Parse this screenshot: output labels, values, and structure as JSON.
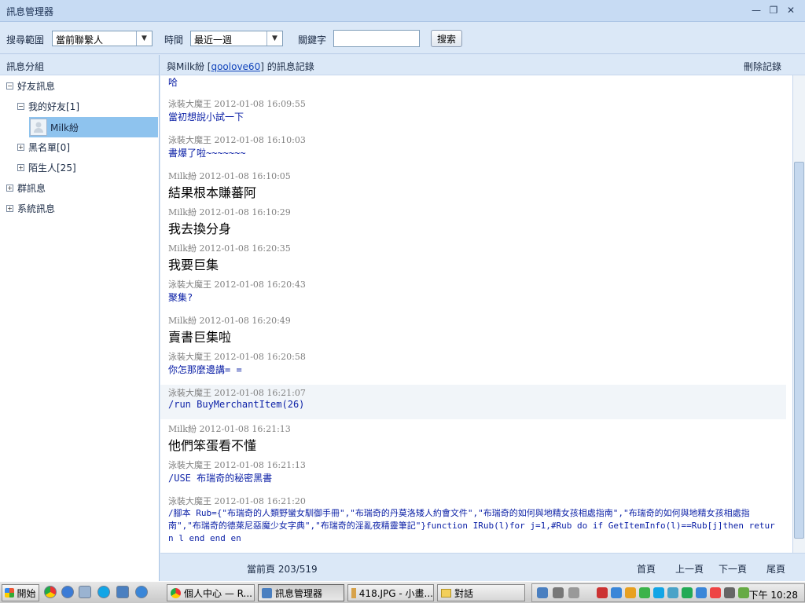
{
  "window": {
    "title": "訊息管理器"
  },
  "toolbar": {
    "scope_label": "搜尋範圍",
    "scope_value": "當前聯繫人",
    "time_label": "時間",
    "time_value": "最近一週",
    "keyword_label": "關鍵字",
    "keyword_value": "",
    "search_button": "搜索"
  },
  "sidebar": {
    "header": "訊息分組",
    "items": [
      {
        "label": "好友訊息",
        "expander": "⊟"
      },
      {
        "label": "我的好友[1]",
        "expander": "⊟"
      },
      {
        "label": "Milk紛",
        "expander": ""
      },
      {
        "label": "黑名單[0]",
        "expander": "⊞"
      },
      {
        "label": "陌生人[25]",
        "expander": "⊞"
      },
      {
        "label": "群訊息",
        "expander": "⊞"
      },
      {
        "label": "系統訊息",
        "expander": "⊞"
      }
    ]
  },
  "conversation": {
    "title_prefix": "與Milk紛 [",
    "contact_id": "qoolove60",
    "title_suffix": "] 的訊息記錄",
    "delete_label": "刪除記錄",
    "top_fragment": "哈",
    "messages": [
      {
        "sender": "泳裝大魔王",
        "time": "2012-01-08 16:09:55",
        "text": "當初想說小試一下",
        "style": "small"
      },
      {
        "sender": "泳裝大魔王",
        "time": "2012-01-08 16:10:03",
        "text": "書爆了啦~~~~~~~",
        "style": "small"
      },
      {
        "sender": "Milk紛",
        "time": "2012-01-08 16:10:05",
        "text": "結果根本賺蕃阿",
        "style": "big"
      },
      {
        "sender": "Milk紛",
        "time": "2012-01-08 16:10:29",
        "text": "我去換分身",
        "style": "big"
      },
      {
        "sender": "Milk紛",
        "time": "2012-01-08 16:20:35",
        "text": "我要巨集",
        "style": "big"
      },
      {
        "sender": "泳裝大魔王",
        "time": "2012-01-08 16:20:43",
        "text": "聚集?",
        "style": "small"
      },
      {
        "sender": "Milk紛",
        "time": "2012-01-08 16:20:49",
        "text": "賣書巨集啦",
        "style": "big"
      },
      {
        "sender": "泳裝大魔王",
        "time": "2012-01-08 16:20:58",
        "text": "你怎那麼邊講= =",
        "style": "small"
      },
      {
        "sender": "泳裝大魔王",
        "time": "2012-01-08 16:21:07",
        "text": "/run BuyMerchantItem(26)",
        "style": "small"
      },
      {
        "sender": "Milk紛",
        "time": "2012-01-08 16:21:13",
        "text": "他們笨蛋看不懂",
        "style": "big"
      },
      {
        "sender": "泳裝大魔王",
        "time": "2012-01-08 16:21:13",
        "text": "/USE 布瑞奇的秘密黑書",
        "style": "small"
      },
      {
        "sender": "泳裝大魔王",
        "time": "2012-01-08 16:21:20",
        "text": "/腳本 Rub={\"布瑞奇的人類野蠻女馴御手冊\",\"布瑞奇的丹莫洛矮人約會文件\",\"布瑞奇的如何與地精女孩相處指南\",\"布瑞奇的如何與地精女孩相處指南\",\"布瑞奇的德萊尼惡魔少女字典\",\"布瑞奇的淫亂夜精靈筆記\"}function IRub(l)for j=1,#Rub do if GetItemInfo(l)==Rub[j]then return l end end en",
        "style": "small"
      }
    ]
  },
  "pager": {
    "current_page": "當前頁 203/519",
    "first": "首頁",
    "prev": "上一頁",
    "next": "下一頁",
    "last": "尾頁"
  },
  "taskbar": {
    "start": "開始",
    "tasks": [
      "個人中心 — R...",
      "訊息管理器",
      "418.JPG - 小畫...",
      "對話"
    ],
    "clock": "下午 10:28"
  }
}
